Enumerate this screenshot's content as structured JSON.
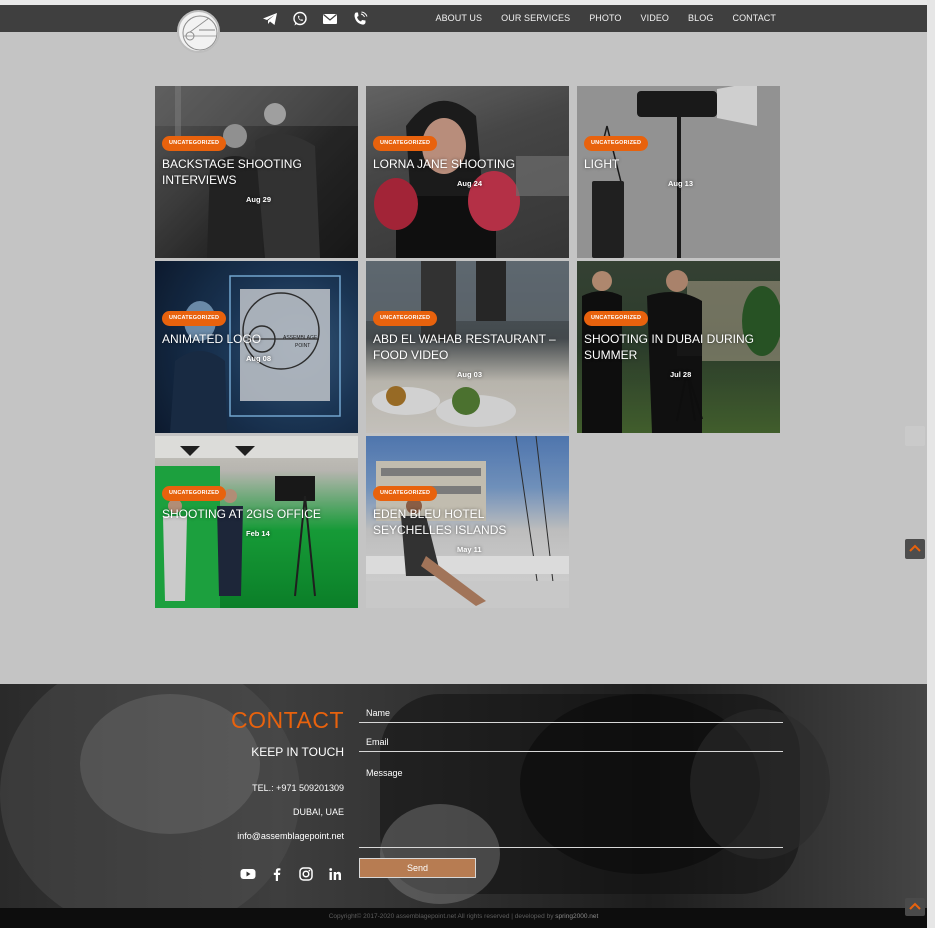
{
  "header": {
    "nav": [
      "ABOUT US",
      "OUR SERVICES",
      "PHOTO",
      "VIDEO",
      "BLOG",
      "CONTACT"
    ],
    "icons": [
      "telegram-icon",
      "whatsapp-icon",
      "email-icon",
      "phone-icon"
    ]
  },
  "posts": [
    {
      "category": "UNCATEGORIZED",
      "title": "BACKSTAGE SHOOTING INTERVIEWS",
      "date": "Aug 29"
    },
    {
      "category": "UNCATEGORIZED",
      "title": "LORNA JANE SHOOTING",
      "date": "Aug 24"
    },
    {
      "category": "UNCATEGORIZED",
      "title": "LIGHT",
      "date": "Aug 13"
    },
    {
      "category": "UNCATEGORIZED",
      "title": "ANIMATED LOGO",
      "date": "Aug 08"
    },
    {
      "category": "UNCATEGORIZED",
      "title": "ABD EL WAHAB RESTAURANT – FOOD VIDEO",
      "date": "Aug 03"
    },
    {
      "category": "UNCATEGORIZED",
      "title": "SHOOTING IN DUBAI DURING SUMMER",
      "date": "Jul 28"
    },
    {
      "category": "UNCATEGORIZED",
      "title": "SHOOTING AT 2GIS OFFICE",
      "date": "Feb 14"
    },
    {
      "category": "UNCATEGORIZED",
      "title": "EDEN BLEU HOTEL SEYCHELLES ISLANDS",
      "date": "May 11"
    }
  ],
  "contact": {
    "title": "CONTACT",
    "subtitle": "KEEP IN TOUCH",
    "tel": "TEL.:  +971 509201309",
    "city": "DUBAI, UAE",
    "email": "info@assemblagepoint.net",
    "socials": [
      "youtube-icon",
      "facebook-icon",
      "instagram-icon",
      "linkedin-icon"
    ]
  },
  "form": {
    "name_label": "Name",
    "email_label": "Email",
    "message_label": "Message",
    "send_label": "Send"
  },
  "footer": {
    "copyright": "Copyright© 2017-2020 assemblagepoint.net All rights reserved | developed by ",
    "developer": "spring2000.net"
  },
  "colors": {
    "accent": "#e8620d",
    "header_bg": "#3f3f3f",
    "page_bg": "#c4c4c4"
  }
}
